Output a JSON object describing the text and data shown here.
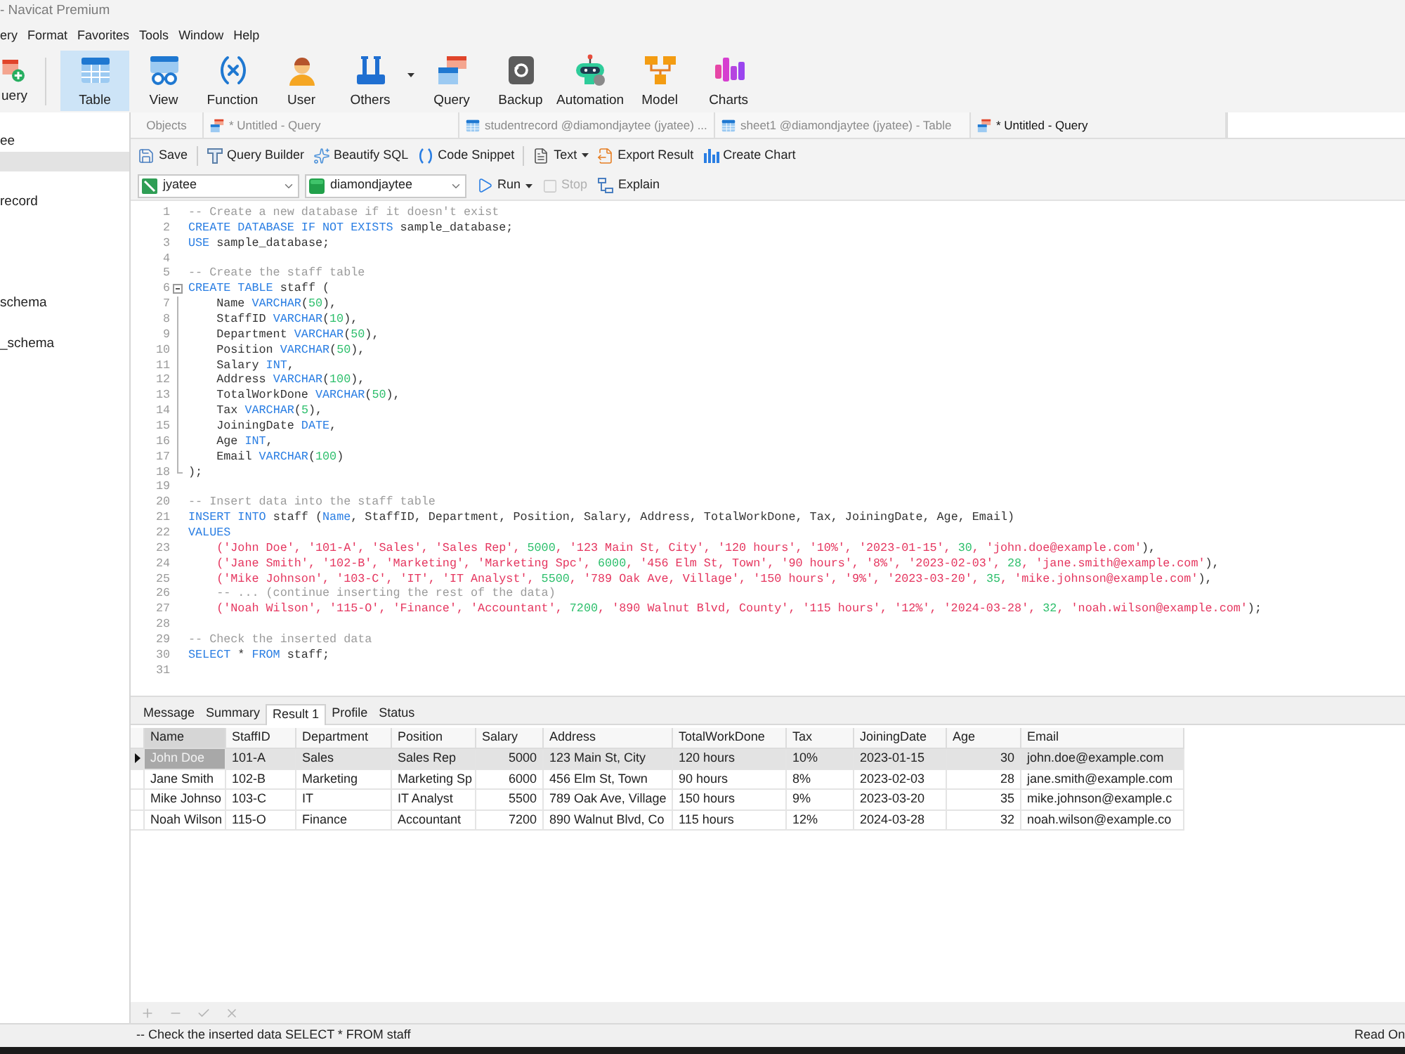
{
  "window": {
    "title": "- Navicat Premium"
  },
  "menu": [
    "ery",
    "Format",
    "Favorites",
    "Tools",
    "Window",
    "Help"
  ],
  "toolbar": [
    {
      "label": "uery",
      "kind": "new-query",
      "selected": false
    },
    {
      "label": "Table",
      "kind": "table",
      "selected": true
    },
    {
      "label": "View",
      "kind": "view",
      "selected": false
    },
    {
      "label": "Function",
      "kind": "function",
      "selected": false
    },
    {
      "label": "User",
      "kind": "user",
      "selected": false
    },
    {
      "label": "Others",
      "kind": "others",
      "selected": false,
      "dropdown": true
    },
    {
      "label": "Query",
      "kind": "query",
      "selected": false
    },
    {
      "label": "Backup",
      "kind": "backup",
      "selected": false
    },
    {
      "label": "Automation",
      "kind": "automation",
      "selected": false
    },
    {
      "label": "Model",
      "kind": "model",
      "selected": false
    },
    {
      "label": "Charts",
      "kind": "charts",
      "selected": false
    }
  ],
  "sidebar": {
    "items": [
      {
        "label": "ee",
        "selected": false
      },
      {
        "selected": true
      },
      {
        "label": "record",
        "selected": false
      },
      {
        "label": "schema",
        "selected": false
      },
      {
        "label": "_schema",
        "selected": false
      }
    ]
  },
  "tabs": [
    {
      "label": "Objects",
      "kind": "objects",
      "selected": false
    },
    {
      "label": "* Untitled - Query",
      "kind": "query",
      "selected": false
    },
    {
      "label": "studentrecord @diamondjaytee (jyatee) ...",
      "kind": "table",
      "selected": false
    },
    {
      "label": "sheet1 @diamondjaytee (jyatee) - Table",
      "kind": "table",
      "selected": false
    },
    {
      "label": "* Untitled - Query",
      "kind": "query",
      "selected": true
    }
  ],
  "editor_toolbar": {
    "groups": [
      [
        {
          "label": "Save",
          "kind": "save"
        }
      ],
      [
        {
          "label": "Query Builder",
          "kind": "query-builder"
        },
        {
          "label": "Beautify SQL",
          "kind": "beautify"
        },
        {
          "label": "Code Snippet",
          "kind": "snippet"
        }
      ],
      [
        {
          "label": "Text",
          "kind": "text",
          "dropdown": true
        },
        {
          "label": "Export Result",
          "kind": "export"
        },
        {
          "label": "Create Chart",
          "kind": "chart"
        }
      ]
    ]
  },
  "query_bar": {
    "connection": {
      "value": "jyatee"
    },
    "database": {
      "value": "diamondjaytee"
    },
    "buttons": [
      {
        "label": "Run",
        "kind": "run",
        "dropdown": true,
        "disabled": false
      },
      {
        "label": "Stop",
        "kind": "stop",
        "disabled": true
      },
      {
        "label": "Explain",
        "kind": "explain",
        "disabled": false
      }
    ]
  },
  "editor": {
    "lines": [
      {
        "number": "1",
        "kind": "plain",
        "parts": [
          {
            "kind": "comment",
            "text": "-- Create a new database if it doesn't exist"
          }
        ]
      },
      {
        "number": "2",
        "kind": "plain",
        "parts": [
          {
            "kind": "keyword",
            "text": "CREATE DATABASE IF NOT EXISTS"
          },
          {
            "kind": "plain",
            "text": " sample_database;"
          }
        ]
      },
      {
        "number": "3",
        "kind": "plain",
        "parts": [
          {
            "kind": "keyword",
            "text": "USE"
          },
          {
            "kind": "plain",
            "text": " sample_database;"
          }
        ]
      },
      {
        "number": "4",
        "kind": "plain"
      },
      {
        "number": "5",
        "kind": "plain",
        "parts": [
          {
            "kind": "comment",
            "text": "-- Create the staff table"
          }
        ]
      },
      {
        "number": "6",
        "kind": "fold_start",
        "expanded": true,
        "parts": [
          {
            "kind": "keyword",
            "text": "CREATE TABLE"
          },
          {
            "kind": "plain",
            "text": " staff ("
          }
        ]
      },
      {
        "number": "7",
        "kind": "fold_body",
        "parts": [
          {
            "kind": "plain",
            "text": "    Name "
          },
          {
            "kind": "keyword",
            "text": "VARCHAR"
          },
          {
            "kind": "plain",
            "text": "("
          },
          {
            "kind": "number",
            "text": "50"
          },
          {
            "kind": "plain",
            "text": "),"
          }
        ]
      },
      {
        "number": "8",
        "kind": "fold_body",
        "parts": [
          {
            "kind": "plain",
            "text": "    StaffID "
          },
          {
            "kind": "keyword",
            "text": "VARCHAR"
          },
          {
            "kind": "plain",
            "text": "("
          },
          {
            "kind": "number",
            "text": "10"
          },
          {
            "kind": "plain",
            "text": "),"
          }
        ]
      },
      {
        "number": "9",
        "kind": "fold_body",
        "parts": [
          {
            "kind": "plain",
            "text": "    Department "
          },
          {
            "kind": "keyword",
            "text": "VARCHAR"
          },
          {
            "kind": "plain",
            "text": "("
          },
          {
            "kind": "number",
            "text": "50"
          },
          {
            "kind": "plain",
            "text": "),"
          }
        ]
      },
      {
        "number": "10",
        "kind": "fold_body",
        "parts": [
          {
            "kind": "plain",
            "text": "    Position "
          },
          {
            "kind": "keyword",
            "text": "VARCHAR"
          },
          {
            "kind": "plain",
            "text": "("
          },
          {
            "kind": "number",
            "text": "50"
          },
          {
            "kind": "plain",
            "text": "),"
          }
        ]
      },
      {
        "number": "11",
        "kind": "fold_body",
        "parts": [
          {
            "kind": "plain",
            "text": "    Salary "
          },
          {
            "kind": "keyword",
            "text": "INT"
          },
          {
            "kind": "plain",
            "text": ","
          }
        ]
      },
      {
        "number": "12",
        "kind": "fold_body",
        "parts": [
          {
            "kind": "plain",
            "text": "    Address "
          },
          {
            "kind": "keyword",
            "text": "VARCHAR"
          },
          {
            "kind": "plain",
            "text": "("
          },
          {
            "kind": "number",
            "text": "100"
          },
          {
            "kind": "plain",
            "text": "),"
          }
        ]
      },
      {
        "number": "13",
        "kind": "fold_body",
        "parts": [
          {
            "kind": "plain",
            "text": "    TotalWorkDone "
          },
          {
            "kind": "keyword",
            "text": "VARCHAR"
          },
          {
            "kind": "plain",
            "text": "("
          },
          {
            "kind": "number",
            "text": "50"
          },
          {
            "kind": "plain",
            "text": "),"
          }
        ]
      },
      {
        "number": "14",
        "kind": "fold_body",
        "parts": [
          {
            "kind": "plain",
            "text": "    Tax "
          },
          {
            "kind": "keyword",
            "text": "VARCHAR"
          },
          {
            "kind": "plain",
            "text": "("
          },
          {
            "kind": "number",
            "text": "5"
          },
          {
            "kind": "plain",
            "text": "),"
          }
        ]
      },
      {
        "number": "15",
        "kind": "fold_body",
        "parts": [
          {
            "kind": "plain",
            "text": "    JoiningDate "
          },
          {
            "kind": "keyword",
            "text": "DATE"
          },
          {
            "kind": "plain",
            "text": ","
          }
        ]
      },
      {
        "number": "16",
        "kind": "fold_body",
        "parts": [
          {
            "kind": "plain",
            "text": "    Age "
          },
          {
            "kind": "keyword",
            "text": "INT"
          },
          {
            "kind": "plain",
            "text": ","
          }
        ]
      },
      {
        "number": "17",
        "kind": "fold_body",
        "parts": [
          {
            "kind": "plain",
            "text": "    Email "
          },
          {
            "kind": "keyword",
            "text": "VARCHAR"
          },
          {
            "kind": "plain",
            "text": "("
          },
          {
            "kind": "number",
            "text": "100"
          },
          {
            "kind": "plain",
            "text": ")"
          }
        ]
      },
      {
        "number": "18",
        "kind": "fold_end",
        "parts": [
          {
            "kind": "plain",
            "text": ");"
          }
        ]
      },
      {
        "number": "19",
        "kind": "plain"
      },
      {
        "number": "20",
        "kind": "plain",
        "parts": [
          {
            "kind": "comment",
            "text": "-- Insert data into the staff table"
          }
        ]
      },
      {
        "number": "21",
        "kind": "plain",
        "parts": [
          {
            "kind": "keyword",
            "text": "INSERT INTO"
          },
          {
            "kind": "plain",
            "text": " staff ("
          },
          {
            "kind": "keyword",
            "text": "Name"
          },
          {
            "kind": "plain",
            "text": ", StaffID, Department, Position, Salary, Address, TotalWorkDone, Tax, JoiningDate, Age, Email)"
          }
        ]
      },
      {
        "number": "22",
        "kind": "plain",
        "parts": [
          {
            "kind": "keyword",
            "text": "VALUES"
          }
        ]
      },
      {
        "number": "23",
        "kind": "plain",
        "parts": [
          {
            "kind": "string",
            "text": "    ('John Doe', '101-A', 'Sales', 'Sales Rep', "
          },
          {
            "kind": "number",
            "text": "5000"
          },
          {
            "kind": "string",
            "text": ", '123 Main St, City', '120 hours', '10%', '2023-01-15', "
          },
          {
            "kind": "number",
            "text": "30"
          },
          {
            "kind": "string",
            "text": ", 'john.doe@example.com'"
          },
          {
            "kind": "plain",
            "text": "),"
          }
        ]
      },
      {
        "number": "24",
        "kind": "plain",
        "parts": [
          {
            "kind": "string",
            "text": "    ('Jane Smith', '102-B', 'Marketing', 'Marketing Spc', "
          },
          {
            "kind": "number",
            "text": "6000"
          },
          {
            "kind": "string",
            "text": ", '456 Elm St, Town', '90 hours', '8%', '2023-02-03', "
          },
          {
            "kind": "number",
            "text": "28"
          },
          {
            "kind": "string",
            "text": ", 'jane.smith@example.com'"
          },
          {
            "kind": "plain",
            "text": "),"
          }
        ]
      },
      {
        "number": "25",
        "kind": "plain",
        "parts": [
          {
            "kind": "string",
            "text": "    ('Mike Johnson', '103-C', 'IT', 'IT Analyst', "
          },
          {
            "kind": "number",
            "text": "5500"
          },
          {
            "kind": "string",
            "text": ", '789 Oak Ave, Village', '150 hours', '9%', '2023-03-20', "
          },
          {
            "kind": "number",
            "text": "35"
          },
          {
            "kind": "string",
            "text": ", 'mike.johnson@example.com'"
          },
          {
            "kind": "plain",
            "text": "),"
          }
        ]
      },
      {
        "number": "26",
        "kind": "plain",
        "parts": [
          {
            "kind": "comment",
            "text": "    -- ... (continue inserting the rest of the data)"
          }
        ]
      },
      {
        "number": "27",
        "kind": "plain",
        "parts": [
          {
            "kind": "string",
            "text": "    ('Noah Wilson', '115-O', 'Finance', 'Accountant', "
          },
          {
            "kind": "number",
            "text": "7200"
          },
          {
            "kind": "string",
            "text": ", '890 Walnut Blvd, County', '115 hours', '12%', '2024-03-28', "
          },
          {
            "kind": "number",
            "text": "32"
          },
          {
            "kind": "string",
            "text": ", 'noah.wilson@example.com'"
          },
          {
            "kind": "plain",
            "text": ");"
          }
        ]
      },
      {
        "number": "28",
        "kind": "plain"
      },
      {
        "number": "29",
        "kind": "plain",
        "parts": [
          {
            "kind": "comment",
            "text": "-- Check the inserted data"
          }
        ]
      },
      {
        "number": "30",
        "kind": "plain",
        "parts": [
          {
            "kind": "keyword",
            "text": "SELECT"
          },
          {
            "kind": "plain",
            "text": " * "
          },
          {
            "kind": "keyword",
            "text": "FROM"
          },
          {
            "kind": "plain",
            "text": " staff;"
          }
        ]
      },
      {
        "number": "31",
        "kind": "plain"
      }
    ]
  },
  "results": {
    "tabs": [
      {
        "label": "Message",
        "selected": false
      },
      {
        "label": "Summary",
        "selected": false
      },
      {
        "label": "Result 1",
        "selected": true
      },
      {
        "label": "Profile",
        "selected": false
      },
      {
        "label": "Status",
        "selected": false
      }
    ],
    "columns": [
      {
        "label": "Name",
        "kind": "text",
        "selected": true
      },
      {
        "label": "StaffID",
        "kind": "text",
        "selected": false
      },
      {
        "label": "Department",
        "kind": "text",
        "selected": false
      },
      {
        "label": "Position",
        "kind": "text",
        "selected": false
      },
      {
        "label": "Salary",
        "kind": "number",
        "selected": false
      },
      {
        "label": "Address",
        "kind": "text",
        "selected": false
      },
      {
        "label": "TotalWorkDone",
        "kind": "text",
        "selected": false
      },
      {
        "label": "Tax",
        "kind": "text",
        "selected": false
      },
      {
        "label": "JoiningDate",
        "kind": "text",
        "selected": false
      },
      {
        "label": "Age",
        "kind": "number",
        "selected": false
      },
      {
        "label": "Email",
        "kind": "text",
        "selected": false
      }
    ],
    "rows": [
      {
        "selected": true,
        "cells": [
          "John Doe",
          "101-A",
          "Sales",
          "Sales Rep",
          "5000",
          "123 Main St, City",
          "120 hours",
          "10%",
          "2023-01-15",
          "30",
          "john.doe@example.com"
        ]
      },
      {
        "selected": false,
        "cells": [
          "Jane Smith",
          "102-B",
          "Marketing",
          "Marketing Sp",
          "6000",
          "456 Elm St, Town",
          "90 hours",
          "8%",
          "2023-02-03",
          "28",
          "jane.smith@example.com"
        ]
      },
      {
        "selected": false,
        "cells": [
          "Mike Johnso",
          "103-C",
          "IT",
          "IT Analyst",
          "5500",
          "789 Oak Ave, Village",
          "150 hours",
          "9%",
          "2023-03-20",
          "35",
          "mike.johnson@example.c"
        ]
      },
      {
        "selected": false,
        "cells": [
          "Noah Wilson",
          "115-O",
          "Finance",
          "Accountant",
          "7200",
          "890 Walnut Blvd, Co",
          "115 hours",
          "12%",
          "2024-03-28",
          "32",
          "noah.wilson@example.co"
        ]
      }
    ],
    "actions": [
      {
        "kind": "add",
        "disabled": true
      },
      {
        "kind": "delete",
        "disabled": true
      },
      {
        "kind": "apply",
        "disabled": true
      },
      {
        "kind": "discard",
        "disabled": true
      }
    ]
  },
  "status_bar": {
    "message": "-- Check the inserted data SELECT * FROM staff",
    "mode": "Read On"
  }
}
